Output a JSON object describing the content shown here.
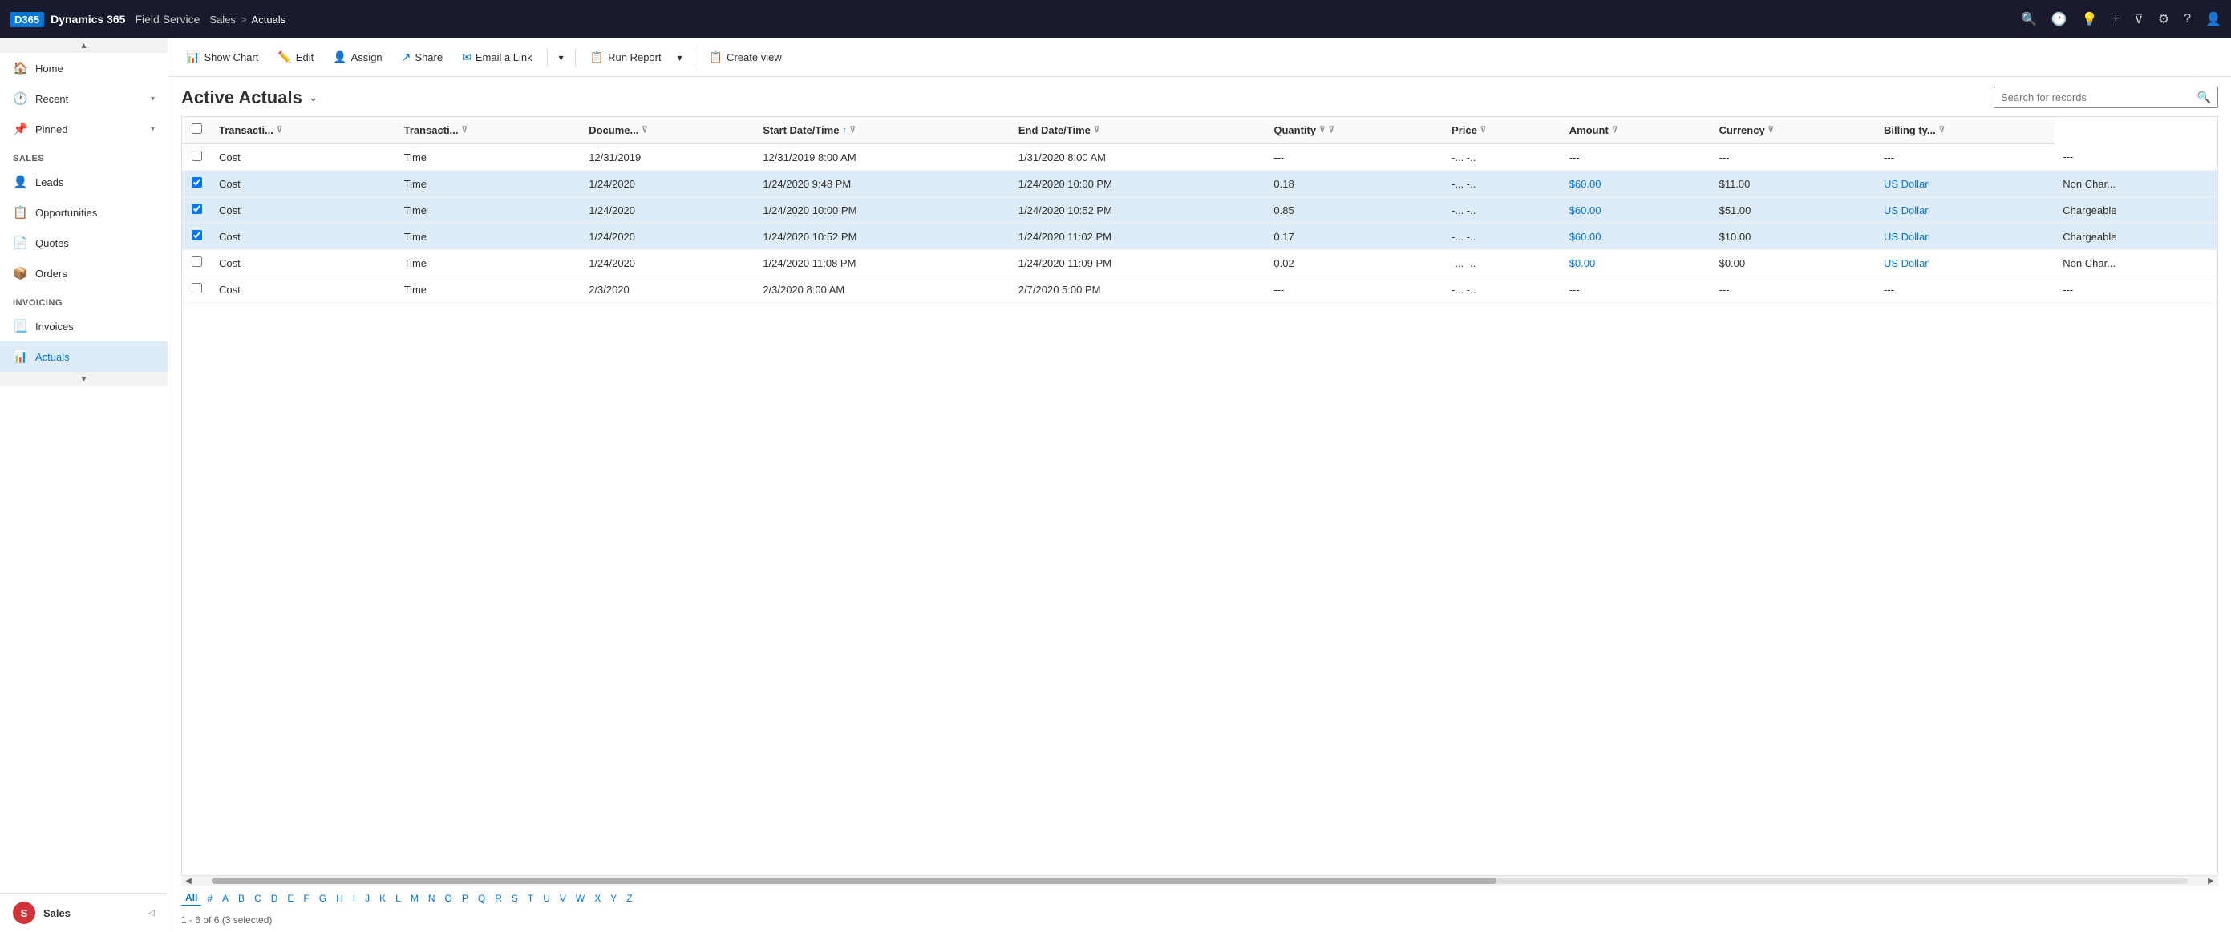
{
  "topnav": {
    "brand_logo": "D365",
    "brand_name": "Dynamics 365",
    "app_name": "Field Service",
    "breadcrumb_parent": "Sales",
    "breadcrumb_separator": ">",
    "breadcrumb_current": "Actuals",
    "icons": {
      "search": "🔍",
      "recent": "🕐",
      "lightbulb": "💡",
      "add": "+",
      "filter": "⊽",
      "settings": "⚙",
      "help": "?",
      "user": "👤"
    }
  },
  "sidebar": {
    "hamburger": "☰",
    "nav_items": [
      {
        "id": "home",
        "icon": "🏠",
        "label": "Home",
        "has_arrow": false
      },
      {
        "id": "recent",
        "icon": "🕐",
        "label": "Recent",
        "has_arrow": true
      },
      {
        "id": "pinned",
        "icon": "📌",
        "label": "Pinned",
        "has_arrow": true
      }
    ],
    "sections": [
      {
        "label": "Sales",
        "items": [
          {
            "id": "leads",
            "icon": "👤",
            "label": "Leads"
          },
          {
            "id": "opportunities",
            "icon": "📋",
            "label": "Opportunities"
          },
          {
            "id": "quotes",
            "icon": "📄",
            "label": "Quotes"
          },
          {
            "id": "orders",
            "icon": "📦",
            "label": "Orders"
          }
        ]
      },
      {
        "label": "Invoicing",
        "items": [
          {
            "id": "invoices",
            "icon": "📃",
            "label": "Invoices"
          },
          {
            "id": "actuals",
            "icon": "📊",
            "label": "Actuals",
            "active": true
          }
        ]
      }
    ],
    "scroll_up_icon": "▲",
    "scroll_down_icon": "▼",
    "footer": {
      "avatar_initials": "S",
      "name": "Sales"
    }
  },
  "toolbar": {
    "buttons": [
      {
        "id": "show-chart",
        "icon": "📊",
        "label": "Show Chart"
      },
      {
        "id": "edit",
        "icon": "✏️",
        "label": "Edit"
      },
      {
        "id": "assign",
        "icon": "👤",
        "label": "Assign"
      },
      {
        "id": "share",
        "icon": "↗",
        "label": "Share"
      },
      {
        "id": "email-link",
        "icon": "✉",
        "label": "Email a Link"
      },
      {
        "id": "more",
        "label": "▾"
      },
      {
        "id": "run-report",
        "icon": "📋",
        "label": "Run Report"
      },
      {
        "id": "run-report-more",
        "label": "▾"
      },
      {
        "id": "create-view",
        "icon": "📋",
        "label": "Create view"
      }
    ]
  },
  "content": {
    "view_title": "Active Actuals",
    "view_dropdown_icon": "⌄",
    "search_placeholder": "Search for records",
    "search_icon": "🔍",
    "columns": [
      {
        "id": "transaction-type",
        "label": "Transacti...",
        "has_filter": true
      },
      {
        "id": "transaction-cat",
        "label": "Transacti...",
        "has_filter": true
      },
      {
        "id": "document",
        "label": "Docume...",
        "has_filter": true
      },
      {
        "id": "start-datetime",
        "label": "Start Date/Time",
        "has_filter": true,
        "has_sort": true
      },
      {
        "id": "end-datetime",
        "label": "End Date/Time",
        "has_filter": true
      },
      {
        "id": "quantity",
        "label": "Quantity",
        "has_filter": true
      },
      {
        "id": "col-extra1",
        "label": "",
        "has_filter": false
      },
      {
        "id": "price",
        "label": "Price",
        "has_filter": true
      },
      {
        "id": "amount",
        "label": "Amount",
        "has_filter": true
      },
      {
        "id": "currency",
        "label": "Currency",
        "has_filter": true
      },
      {
        "id": "billing-type",
        "label": "Billing ty...",
        "has_filter": true
      }
    ],
    "rows": [
      {
        "selected": false,
        "transaction_type": "Cost",
        "transaction_cat": "Time",
        "document": "12/31/2019",
        "start_datetime": "12/31/2019 8:00 AM",
        "end_datetime": "1/31/2020 8:00 AM",
        "quantity": "---",
        "extra1": "-...",
        "extra2": "-..",
        "price": "---",
        "amount": "---",
        "currency": "---",
        "billing_type": "---"
      },
      {
        "selected": true,
        "transaction_type": "Cost",
        "transaction_cat": "Time",
        "document": "1/24/2020",
        "start_datetime": "1/24/2020 9:48 PM",
        "end_datetime": "1/24/2020 10:00 PM",
        "quantity": "0.18",
        "extra1": "-...",
        "extra2": "-..",
        "price": "$60.00",
        "amount": "$11.00",
        "currency": "US Dollar",
        "billing_type": "Non Char..."
      },
      {
        "selected": true,
        "transaction_type": "Cost",
        "transaction_cat": "Time",
        "document": "1/24/2020",
        "start_datetime": "1/24/2020 10:00 PM",
        "end_datetime": "1/24/2020 10:52 PM",
        "quantity": "0.85",
        "extra1": "-...",
        "extra2": "-..",
        "price": "$60.00",
        "amount": "$51.00",
        "currency": "US Dollar",
        "billing_type": "Chargeable"
      },
      {
        "selected": true,
        "transaction_type": "Cost",
        "transaction_cat": "Time",
        "document": "1/24/2020",
        "start_datetime": "1/24/2020 10:52 PM",
        "end_datetime": "1/24/2020 11:02 PM",
        "quantity": "0.17",
        "extra1": "-...",
        "extra2": "-..",
        "price": "$60.00",
        "amount": "$10.00",
        "currency": "US Dollar",
        "billing_type": "Chargeable"
      },
      {
        "selected": false,
        "transaction_type": "Cost",
        "transaction_cat": "Time",
        "document": "1/24/2020",
        "start_datetime": "1/24/2020 11:08 PM",
        "end_datetime": "1/24/2020 11:09 PM",
        "quantity": "0.02",
        "extra1": "-...",
        "extra2": "-..",
        "price": "$0.00",
        "amount": "$0.00",
        "currency": "US Dollar",
        "billing_type": "Non Char..."
      },
      {
        "selected": false,
        "transaction_type": "Cost",
        "transaction_cat": "Time",
        "document": "2/3/2020",
        "start_datetime": "2/3/2020 8:00 AM",
        "end_datetime": "2/7/2020 5:00 PM",
        "quantity": "---",
        "extra1": "-...",
        "extra2": "-..",
        "price": "---",
        "amount": "---",
        "currency": "---",
        "billing_type": "---"
      }
    ],
    "alpha_nav": {
      "active": "All",
      "letters": [
        "All",
        "#",
        "A",
        "B",
        "C",
        "D",
        "E",
        "F",
        "G",
        "H",
        "I",
        "J",
        "K",
        "L",
        "M",
        "N",
        "O",
        "P",
        "Q",
        "R",
        "S",
        "T",
        "U",
        "V",
        "W",
        "X",
        "Y",
        "Z"
      ]
    },
    "status_bar": "1 - 6 of 6 (3 selected)"
  }
}
